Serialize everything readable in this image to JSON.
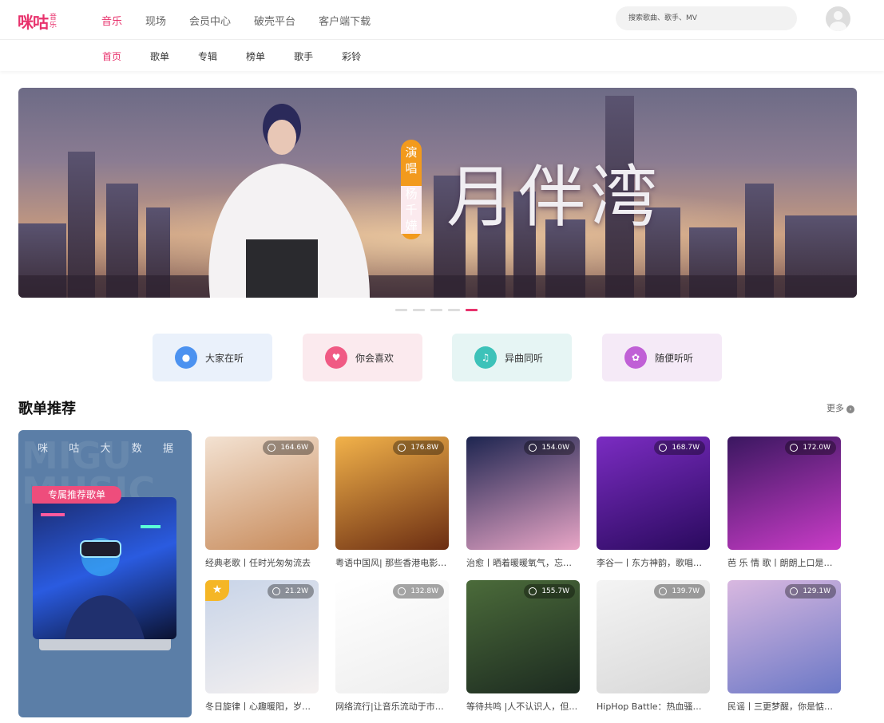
{
  "header": {
    "logo_main": "咪咕",
    "logo_sub": "音乐",
    "nav": [
      "音乐",
      "现场",
      "会员中心",
      "破壳平台",
      "客户端下载"
    ],
    "search_placeholder": "搜索歌曲、歌手、MV"
  },
  "subnav": [
    "首页",
    "歌单",
    "专辑",
    "榜单",
    "歌手",
    "彩铃"
  ],
  "banner": {
    "title": "月伴湾",
    "tag_line1": "演唱",
    "tag_line2": "杨千嬅",
    "slides": 5,
    "active_slide": 5
  },
  "tiles": [
    {
      "label": "大家在听",
      "icon": "water-drop-icon"
    },
    {
      "label": "你会喜欢",
      "icon": "heart-icon"
    },
    {
      "label": "异曲同听",
      "icon": "headphone-icon"
    },
    {
      "label": "随便听听",
      "icon": "flower-icon"
    }
  ],
  "section": {
    "title": "歌单推荐",
    "more": "更多"
  },
  "feature": {
    "watermark": "MIGU MUSIC",
    "spaced": [
      "咪",
      "咕",
      "大",
      "数",
      "据"
    ],
    "ribbon": "专属推荐歌单"
  },
  "playlists": [
    {
      "count": "164.6W",
      "caption": "经典老歌丨任时光匆匆流去",
      "colors": [
        "#f3e2d2",
        "#c78a5a"
      ]
    },
    {
      "count": "176.8W",
      "caption": "粤语中国风| 那些香港电影里的中国风",
      "colors": [
        "#f2b24a",
        "#6b2d12"
      ]
    },
    {
      "count": "154.0W",
      "caption": "治愈丨晒着暖暖氧气，忘了烦恼",
      "colors": [
        "#1d2550",
        "#e8a5c6"
      ]
    },
    {
      "count": "168.7W",
      "caption": "李谷一丨东方神韵，歌唱太阳的女人",
      "colors": [
        "#7b2cc2",
        "#2a0a5e"
      ]
    },
    {
      "count": "172.0W",
      "caption": "芭 乐 情 歌丨朗朗上口是心动的信号",
      "colors": [
        "#3a1760",
        "#c93cc7"
      ]
    },
    {
      "count": "21.2W",
      "caption": "冬日旋律丨心趣暖阳，岁月静好",
      "colors": [
        "#c8d4e8",
        "#f5f1f0"
      ],
      "star": true
    },
    {
      "count": "132.8W",
      "caption": "网络流行|让音乐流动于市井生活",
      "colors": [
        "#ffffff",
        "#eeeeee"
      ]
    },
    {
      "count": "155.7W",
      "caption": "等待共鸣 |人不认识人，但歌认得",
      "colors": [
        "#4b6b3a",
        "#1c2a20"
      ]
    },
    {
      "count": "139.7W",
      "caption": "HipHop Battle：热血骚动拉满",
      "colors": [
        "#f4f4f4",
        "#d8d8d8"
      ]
    },
    {
      "count": "129.1W",
      "caption": "民谣丨三更梦醒，你是惦上心头的人",
      "colors": [
        "#d9b8e0",
        "#6b78c6"
      ]
    }
  ]
}
